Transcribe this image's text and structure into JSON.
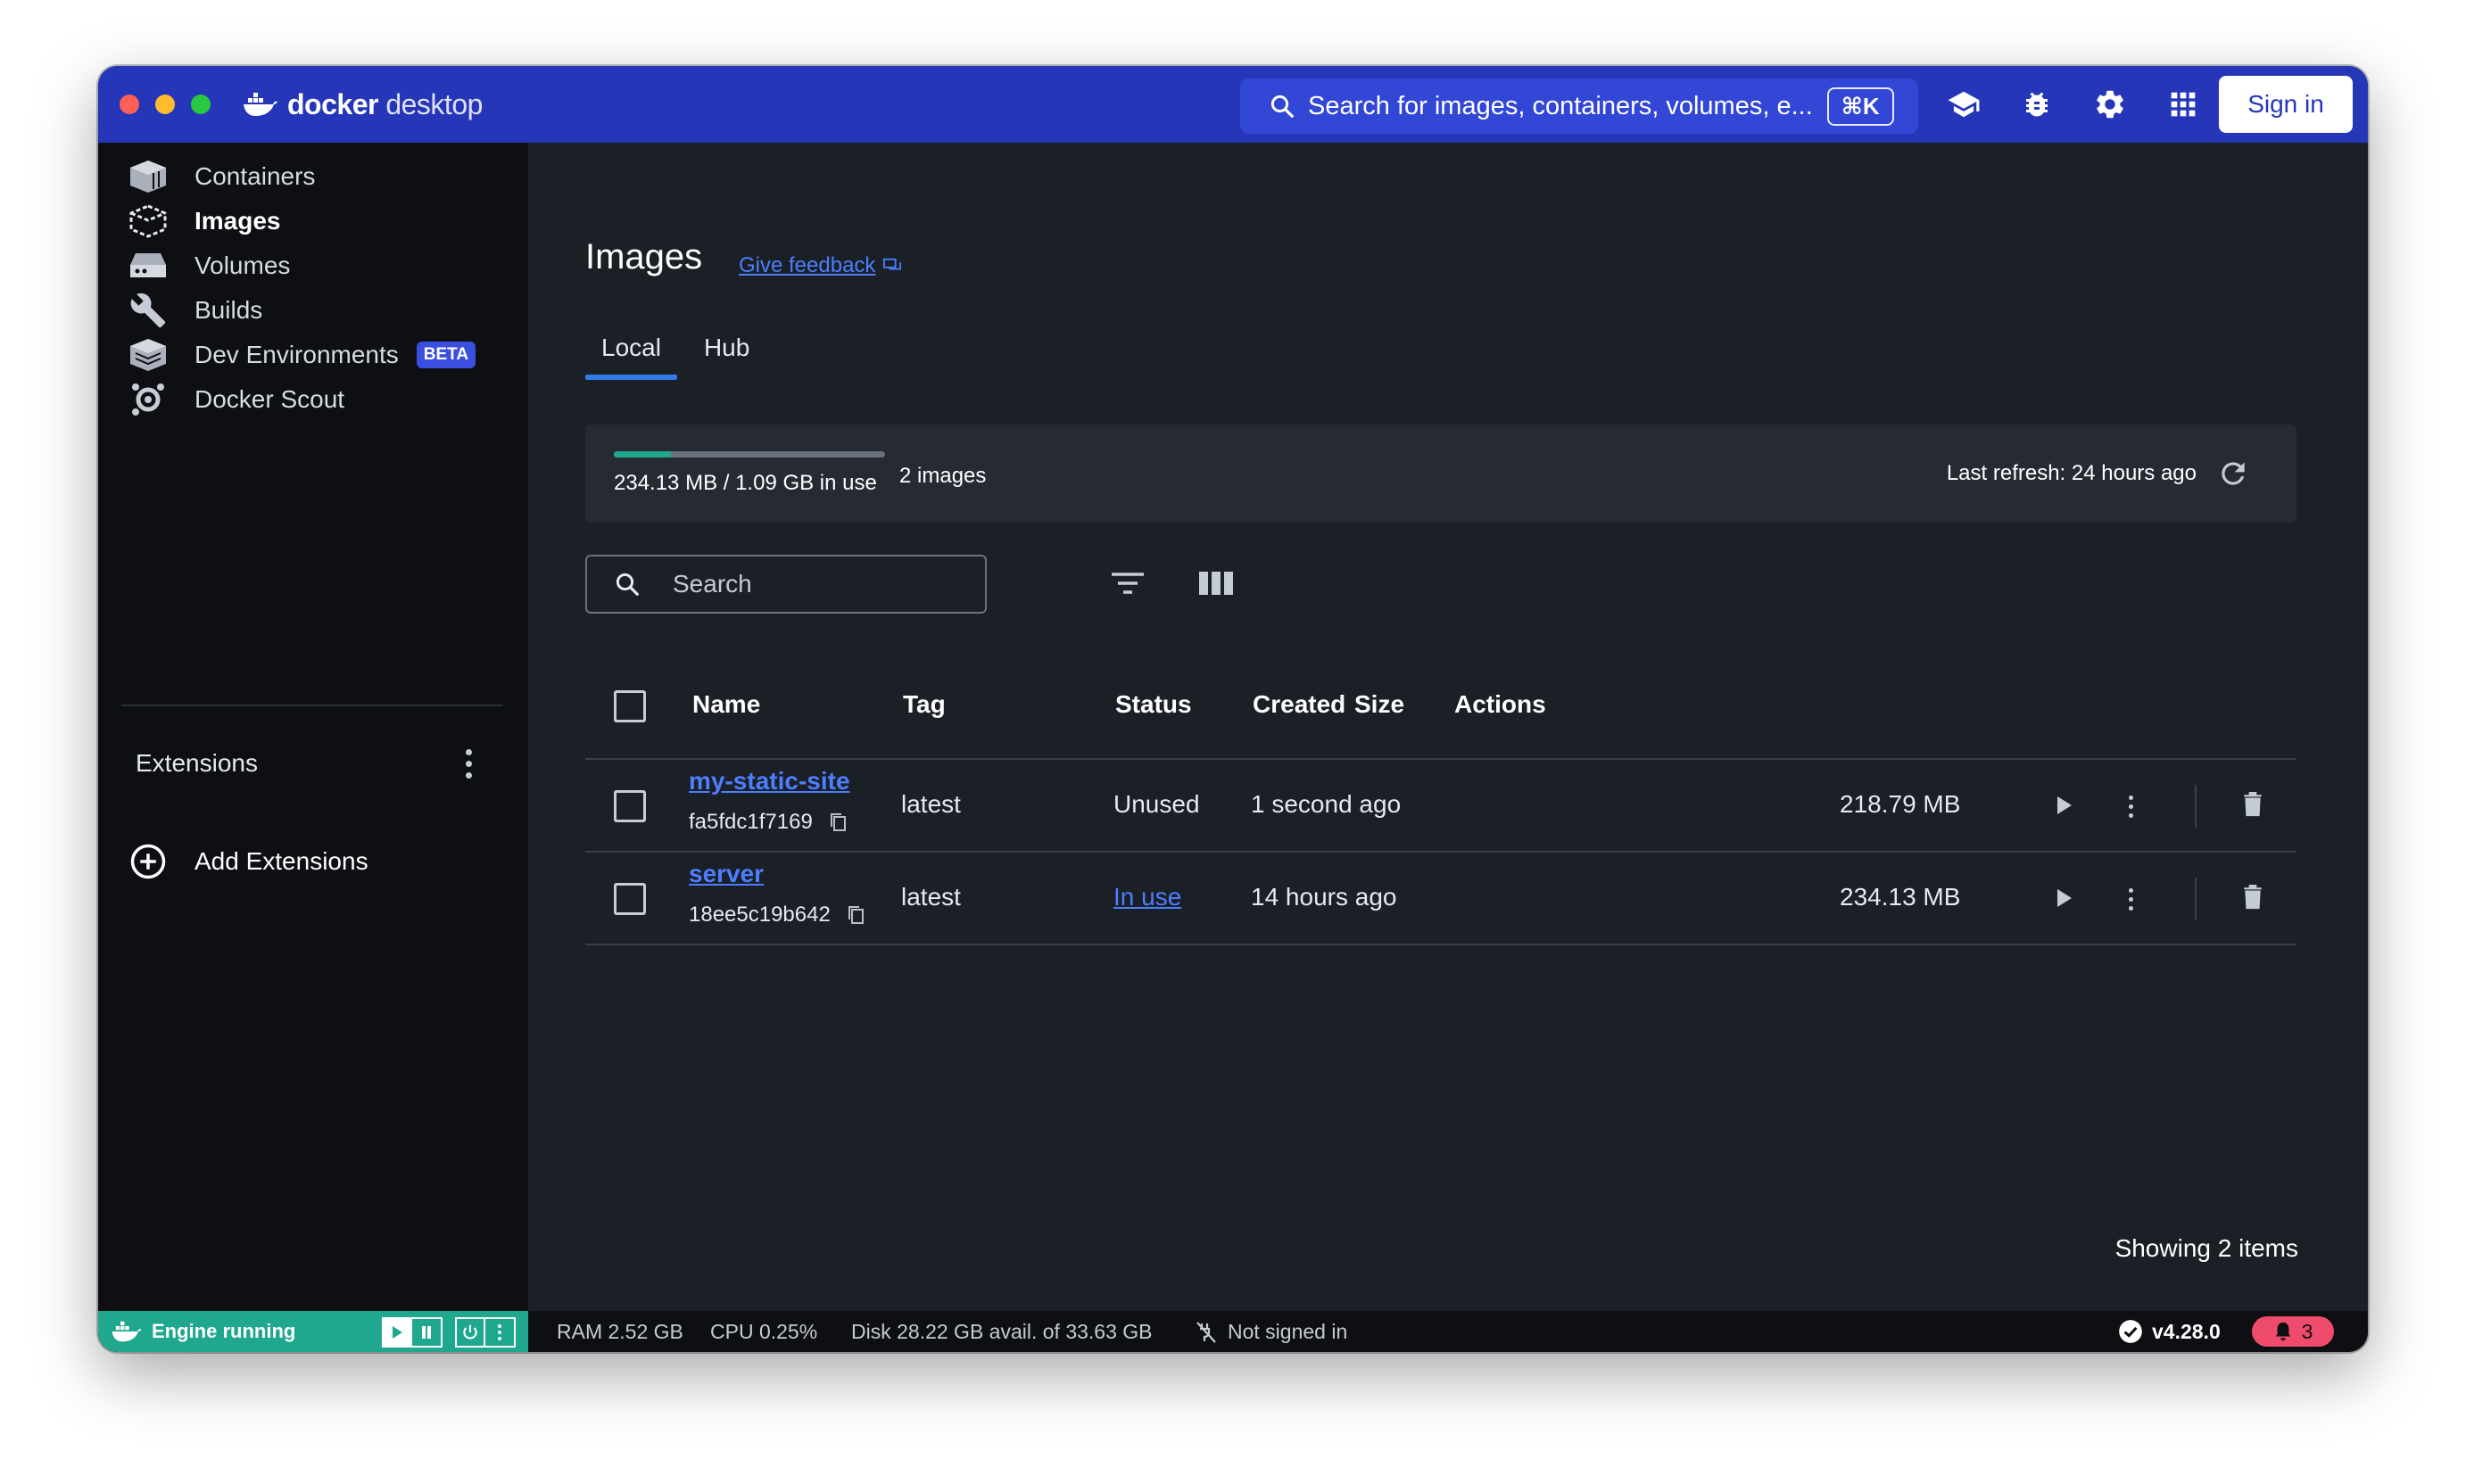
{
  "app": {
    "logo_bold": "docker",
    "logo_light": "desktop"
  },
  "titlebar": {
    "search_placeholder": "Search for images, containers, volumes, e...",
    "search_shortcut": "⌘K",
    "icons": [
      "learning-center-icon",
      "troubleshoot-icon",
      "settings-icon",
      "extensions-grid-icon"
    ],
    "sign_in": "Sign in"
  },
  "sidebar": {
    "items": [
      {
        "label": "Containers",
        "icon": "containers-icon"
      },
      {
        "label": "Images",
        "icon": "images-icon",
        "active": true
      },
      {
        "label": "Volumes",
        "icon": "volumes-icon"
      },
      {
        "label": "Builds",
        "icon": "builds-icon"
      },
      {
        "label": "Dev Environments",
        "icon": "dev-environments-icon",
        "badge": "BETA"
      },
      {
        "label": "Docker Scout",
        "icon": "docker-scout-icon"
      }
    ],
    "extensions_label": "Extensions",
    "add_extensions": "Add Extensions"
  },
  "page": {
    "title": "Images",
    "feedback": "Give feedback",
    "tabs": [
      "Local",
      "Hub"
    ],
    "active_tab": "Local",
    "usage": {
      "text": "234.13 MB / 1.09 GB in use",
      "count": "2 images",
      "fraction": 0.21
    },
    "last_refresh": "Last refresh: 24 hours ago",
    "search_placeholder": "Search",
    "showing": "Showing 2 items"
  },
  "table": {
    "headers": {
      "name": "Name",
      "tag": "Tag",
      "status": "Status",
      "created": "Created",
      "size": "Size",
      "actions": "Actions"
    },
    "rows": [
      {
        "name": "my-static-site",
        "id": "fa5fdc1f7169",
        "tag": "latest",
        "status": "Unused",
        "created": "1 second ago",
        "size": "218.79 MB"
      },
      {
        "name": "server",
        "id": "18ee5c19b642",
        "tag": "latest",
        "status": "In use",
        "created": "14 hours ago",
        "size": "234.13 MB"
      }
    ]
  },
  "footer": {
    "engine": "Engine running",
    "ram": "RAM 2.52 GB",
    "cpu": "CPU 0.25%",
    "disk": "Disk 28.22 GB avail. of 33.63 GB",
    "signed": "Not signed in",
    "version": "v4.28.0",
    "notifications": "3"
  },
  "colors": {
    "titlebar": "#2536b8",
    "accent_link": "#4c7fff",
    "engine_green": "#1fa88e",
    "notif_red": "#ef4b6d"
  }
}
